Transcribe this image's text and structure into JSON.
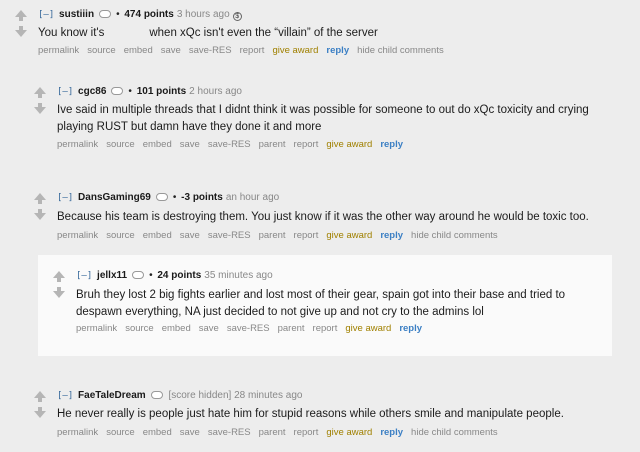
{
  "comments": [
    {
      "author": "sustiiin",
      "score": "474 points",
      "time": "3 hours ago",
      "gilded": "$",
      "body_start": "You know it's",
      "body_end": "when xQc isn't even the “villain” of the server",
      "actions": [
        "permalink",
        "source",
        "embed",
        "save",
        "save-RES",
        "report",
        "give award",
        "reply",
        "hide child comments"
      ]
    },
    {
      "author": "cgc86",
      "score": "101 points",
      "time": "2 hours ago",
      "body_line1": "Ive said in multiple threads that I didnt think it was possible for someone to out do xQc toxicity and crying",
      "body_line2": "playing RUST but damn have they done it and more",
      "actions": [
        "permalink",
        "source",
        "embed",
        "save",
        "save-RES",
        "parent",
        "report",
        "give award",
        "reply"
      ]
    },
    {
      "author": "DansGaming69",
      "score": "-3 points",
      "time": "an hour ago",
      "body": "Because his team is destroying them. You just know if it was the other way around he would be toxic too.",
      "actions": [
        "permalink",
        "source",
        "embed",
        "save",
        "save-RES",
        "parent",
        "report",
        "give award",
        "reply",
        "hide child comments"
      ]
    },
    {
      "author": "jellx11",
      "score": "24 points",
      "time": "35 minutes ago",
      "body_line1": "Bruh they lost 2 big fights earlier and lost most of their gear, spain got into their base and tried to",
      "body_line2": "despawn everything, NA just decided to not give up and not cry to the admins lol",
      "actions": [
        "permalink",
        "source",
        "embed",
        "save",
        "save-RES",
        "parent",
        "report",
        "give award",
        "reply"
      ]
    },
    {
      "author": "FaeTaleDream",
      "score": "[score hidden]",
      "time": "28 minutes ago",
      "body": "He never really is people just hate him for stupid reasons while others smile and manipulate people.",
      "actions": [
        "permalink",
        "source",
        "embed",
        "save",
        "save-RES",
        "parent",
        "report",
        "give award",
        "reply",
        "hide child comments"
      ]
    }
  ],
  "toggle_label": "[–]",
  "dot": "•"
}
